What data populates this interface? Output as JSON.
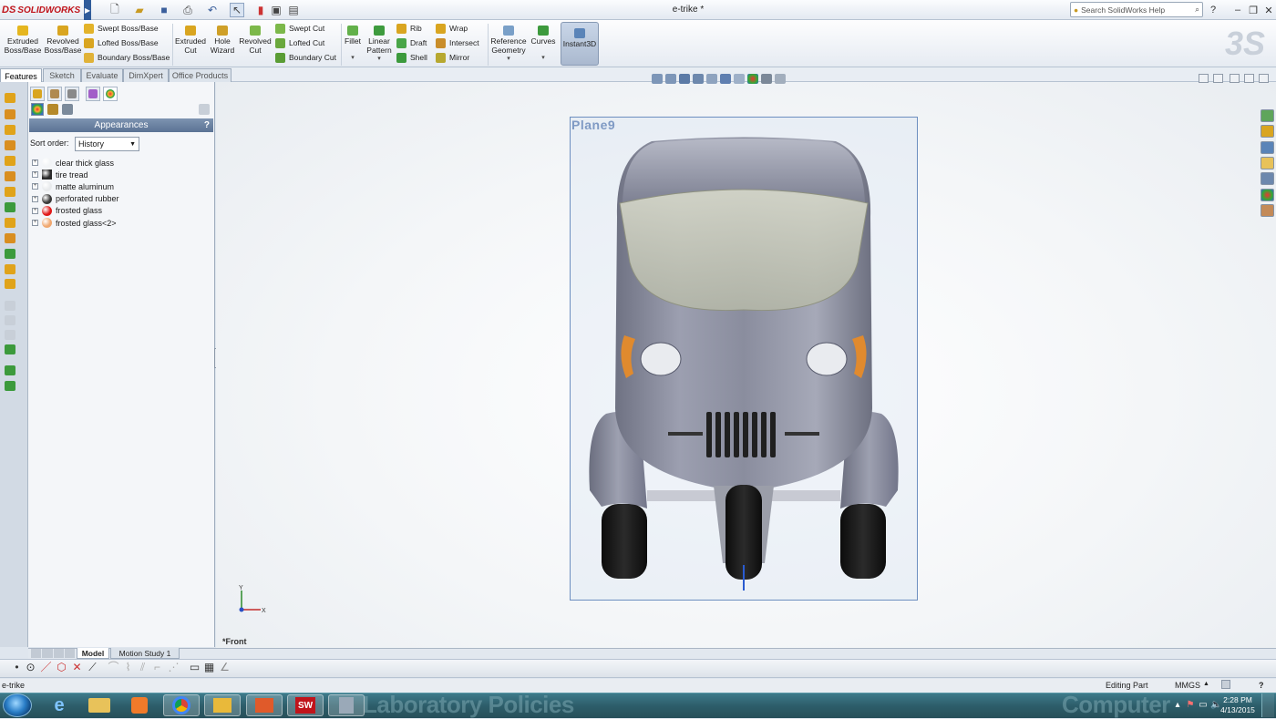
{
  "app": {
    "brand_prefix": "DS",
    "brand": "SOLIDWORKS",
    "window_title": "e-trike *"
  },
  "search": {
    "placeholder": "Search SolidWorks Help"
  },
  "ribbon": {
    "extruded_boss": "Extruded Boss/Base",
    "revolved_boss": "Revolved Boss/Base",
    "swept_boss": "Swept Boss/Base",
    "lofted_boss": "Lofted Boss/Base",
    "boundary_boss": "Boundary Boss/Base",
    "extruded_cut": "Extruded Cut",
    "hole_wizard": "Hole Wizard",
    "revolved_cut": "Revolved Cut",
    "swept_cut": "Swept Cut",
    "lofted_cut": "Lofted Cut",
    "boundary_cut": "Boundary Cut",
    "fillet": "Fillet",
    "linear_pattern": "Linear Pattern",
    "rib": "Rib",
    "draft": "Draft",
    "shell": "Shell",
    "wrap": "Wrap",
    "intersect": "Intersect",
    "mirror": "Mirror",
    "reference_geometry": "Reference Geometry",
    "curves": "Curves",
    "instant3d": "Instant3D"
  },
  "command_tabs": [
    "Features",
    "Sketch",
    "Evaluate",
    "DimXpert",
    "Office Products"
  ],
  "panel": {
    "header": "Appearances",
    "help_glyph": "?",
    "sort_label": "Sort order:",
    "sort_value": "History",
    "items": [
      {
        "label": "clear thick glass",
        "color": "#f2f4f6"
      },
      {
        "label": "tire tread",
        "color": "#2b2b2b"
      },
      {
        "label": "matte aluminum",
        "color": "#e8eaec"
      },
      {
        "label": "perforated rubber",
        "color": "#3a3a3a"
      },
      {
        "label": "frosted glass",
        "color": "#e01818"
      },
      {
        "label": "frosted glass<2>",
        "color": "#f0a870"
      }
    ]
  },
  "viewport": {
    "plane_label": "Plane9",
    "view_label": "*Front",
    "axis_y": "Y",
    "axis_x": "X"
  },
  "bottom_tabs": [
    "Model",
    "Motion Study 1"
  ],
  "status": {
    "left": "e-trike",
    "mode": "Editing Part",
    "units": "MMGS",
    "help_glyph": "?"
  },
  "taskbar": {
    "background_text_1": "Laboratory Policies",
    "background_text_2": "Computer",
    "time": "2:28 PM",
    "date": "4/13/2015"
  },
  "colors": {
    "accent": "#5b7394",
    "body_paint": "#8a8d9e",
    "tire": "#151515",
    "indicator": "#e08a2e"
  }
}
